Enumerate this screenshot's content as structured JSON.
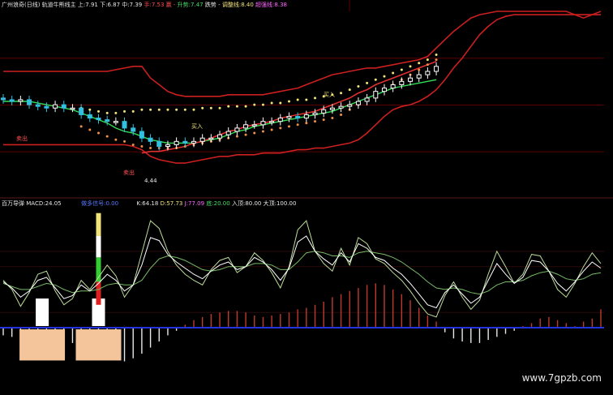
{
  "colors": {
    "background": "#000000",
    "divider": "#5a1a1a",
    "grid": "#5b0000",
    "channel": "#cc1f1f",
    "dots_upper": "#f2e27a",
    "dots_lower": "#f09048",
    "ma_green": "#33dd55",
    "ma_red": "#e03030",
    "candle_up": "#ffffff",
    "candle_down": "#33c0e0",
    "macd_pos": "#c0392b",
    "macd_neg": "#e8e8e8",
    "zero_line": "#2233dd",
    "kdj_k": "#ffffff",
    "kdj_d": "#77bb66",
    "kdj_j": "#bbdd99",
    "block_fill": "#f4c49b",
    "label_white": "#e6e6e6",
    "label_yellow": "#f2e27a",
    "label_orange": "#f08a3a",
    "label_red": "#ff4d4d",
    "label_green": "#44dd66",
    "label_blue": "#5577ff",
    "label_magenta": "#ff66ff"
  },
  "top_header": {
    "title": "广州浪奇(日线) 轨道牛熊线主",
    "up_label": "上:",
    "up_value": "7.91",
    "down_label": "下:",
    "down_value": "6.87",
    "mid_label": "中:",
    "mid_value": "7.39",
    "hold_label": "手:",
    "hold_value": "7.53",
    "buy_label": "赢 -",
    "rise_label": "升势:",
    "rise_value": "7.47",
    "fall_label": "跌势 -",
    "warn_label": "调整线:",
    "warn_value": "8.40",
    "strong_label": "超强线:",
    "strong_value": "8.38"
  },
  "bottom_header": {
    "name": "百万导弹",
    "macd_label": "MACD:",
    "macd_value": "24.05",
    "signal_label": "做多信号:",
    "signal_value": "0.00",
    "k_label": "K:",
    "k_value": "64.18",
    "d_label": "D:",
    "d_value": "57.73",
    "j_label": "J:",
    "j_value": "77.09",
    "bottom_label": "底:",
    "bottom_value": "20.00",
    "entry_label": "入顶:",
    "entry_value": "80.00",
    "top_label": "大顶:",
    "top_value": "100.00"
  },
  "annotations": [
    {
      "text": "卖出"
    },
    {
      "text": "买入"
    },
    {
      "text": "买入"
    },
    {
      "text": "4.44"
    },
    {
      "text": "卖出"
    }
  ],
  "watermark": "www.7gpzb.com",
  "chart_data": [
    {
      "type": "line",
      "name": "price_panel",
      "n": 70,
      "ylim": [
        4.0,
        9.4
      ],
      "series": [
        {
          "key": "channel_upper",
          "values": [
            7.6,
            7.6,
            7.6,
            7.6,
            7.6,
            7.6,
            7.6,
            7.6,
            7.6,
            7.6,
            7.6,
            7.6,
            7.6,
            7.65,
            7.7,
            7.75,
            7.75,
            7.4,
            7.2,
            7.0,
            6.9,
            6.85,
            6.85,
            6.85,
            6.85,
            6.85,
            6.9,
            6.9,
            6.9,
            6.9,
            6.9,
            6.95,
            7.0,
            7.05,
            7.1,
            7.2,
            7.3,
            7.4,
            7.5,
            7.55,
            7.6,
            7.65,
            7.7,
            7.7,
            7.75,
            7.8,
            7.85,
            7.9,
            7.95,
            8.05,
            8.3,
            8.55,
            8.8,
            9.0,
            9.2,
            9.3,
            9.35,
            9.4,
            9.4,
            9.4,
            9.4,
            9.4,
            9.4,
            9.4,
            9.4,
            9.4,
            9.3,
            9.2,
            9.3,
            9.4
          ]
        },
        {
          "key": "channel_lower",
          "values": [
            5.4,
            5.4,
            5.4,
            5.4,
            5.4,
            5.4,
            5.4,
            5.4,
            5.4,
            5.4,
            5.4,
            5.4,
            5.4,
            5.4,
            5.4,
            5.35,
            5.25,
            5.05,
            4.95,
            4.9,
            4.85,
            4.85,
            4.9,
            4.95,
            5.0,
            5.05,
            5.05,
            5.1,
            5.1,
            5.1,
            5.15,
            5.15,
            5.15,
            5.2,
            5.25,
            5.25,
            5.3,
            5.3,
            5.35,
            5.4,
            5.45,
            5.55,
            5.75,
            6.0,
            6.25,
            6.45,
            6.55,
            6.6,
            6.7,
            6.85,
            7.05,
            7.35,
            7.7,
            8.0,
            8.35,
            8.7,
            8.95,
            9.15,
            9.25,
            9.3,
            9.3,
            9.3,
            9.3,
            9.3,
            9.3,
            9.3,
            9.3,
            9.3,
            9.3,
            9.3
          ]
        },
        {
          "key": "dots_upper",
          "values": [
            null,
            null,
            null,
            null,
            null,
            null,
            null,
            null,
            null,
            6.5,
            6.45,
            6.4,
            6.35,
            6.35,
            6.4,
            6.4,
            6.45,
            6.45,
            6.45,
            6.45,
            6.45,
            6.45,
            6.45,
            6.5,
            6.5,
            6.5,
            6.55,
            6.55,
            6.55,
            6.6,
            6.6,
            6.65,
            6.65,
            6.7,
            6.75,
            6.75,
            6.8,
            6.85,
            6.9,
            6.95,
            7.05,
            7.15,
            7.25,
            7.35,
            7.45,
            7.55,
            7.65,
            7.75,
            7.85,
            7.95,
            8.1,
            null,
            null,
            null,
            null,
            null,
            null,
            null,
            null,
            null,
            null,
            null,
            null,
            null,
            null,
            null,
            null,
            null,
            null,
            null
          ]
        },
        {
          "key": "dots_lower",
          "values": [
            null,
            null,
            null,
            null,
            null,
            null,
            null,
            null,
            null,
            5.95,
            5.85,
            5.75,
            5.65,
            5.55,
            5.5,
            5.4,
            5.35,
            5.3,
            5.3,
            5.3,
            5.3,
            5.35,
            5.4,
            5.45,
            5.5,
            5.55,
            5.6,
            5.65,
            5.7,
            5.75,
            5.8,
            5.85,
            5.9,
            5.95,
            6.0,
            6.05,
            6.1,
            6.15,
            6.2,
            6.3,
            6.45,
            6.6,
            6.75,
            6.9,
            7.05,
            7.2,
            7.35,
            7.5,
            7.65,
            7.8,
            7.95,
            null,
            null,
            null,
            null,
            null,
            null,
            null,
            null,
            null,
            null,
            null,
            null,
            null,
            null,
            null,
            null,
            null,
            null,
            null
          ]
        },
        {
          "key": "ma_green",
          "values": [
            6.7,
            6.7,
            6.7,
            6.7,
            6.65,
            6.6,
            6.55,
            6.5,
            6.45,
            6.35,
            6.25,
            6.15,
            6.05,
            5.9,
            5.8,
            5.75,
            5.65,
            5.55,
            5.5,
            5.45,
            5.45,
            5.45,
            5.45,
            5.5,
            5.55,
            5.6,
            5.7,
            5.8,
            5.85,
            5.95,
            6.0,
            6.05,
            6.1,
            6.15,
            6.2,
            6.25,
            6.3,
            6.35,
            6.4,
            6.5,
            6.6,
            6.7,
            6.8,
            6.9,
            7.0,
            7.1,
            7.15,
            7.2,
            7.25,
            7.3,
            7.35,
            null,
            null,
            null,
            null,
            null,
            null,
            null,
            null,
            null,
            null,
            null,
            null,
            null,
            null,
            null,
            null,
            null,
            null,
            null
          ]
        },
        {
          "key": "ma_red",
          "values": [
            null,
            null,
            null,
            null,
            null,
            null,
            null,
            null,
            null,
            null,
            null,
            null,
            null,
            null,
            null,
            null,
            5.15,
            5.2,
            5.2,
            5.25,
            5.3,
            5.35,
            5.45,
            5.5,
            5.6,
            5.7,
            5.8,
            5.85,
            5.95,
            6.0,
            6.05,
            6.1,
            6.2,
            6.25,
            6.3,
            6.35,
            6.4,
            6.5,
            6.6,
            6.7,
            6.8,
            6.95,
            7.05,
            7.2,
            7.3,
            7.4,
            7.5,
            7.6,
            7.7,
            7.8,
            7.9,
            null,
            null,
            null,
            null,
            null,
            null,
            null,
            null,
            null,
            null,
            null,
            null,
            null,
            null,
            null,
            null,
            null,
            null,
            null
          ]
        },
        {
          "key": "candle_o",
          "values": [
            6.8,
            6.75,
            6.7,
            6.75,
            6.6,
            6.55,
            6.5,
            6.6,
            6.5,
            6.5,
            6.3,
            6.2,
            6.15,
            6.1,
            6.1,
            5.9,
            5.8,
            5.6,
            5.5,
            5.35,
            5.4,
            5.5,
            5.45,
            5.5,
            5.6,
            5.6,
            5.7,
            5.8,
            5.9,
            6.0,
            6.0,
            6.1,
            6.1,
            6.2,
            6.25,
            6.2,
            6.3,
            6.35,
            6.45,
            6.5,
            6.55,
            6.6,
            6.7,
            6.8,
            7.0,
            7.1,
            7.2,
            7.3,
            7.4,
            7.5,
            7.6,
            null,
            null,
            null,
            null,
            null,
            null,
            null,
            null,
            null,
            null,
            null,
            null,
            null,
            null,
            null,
            null,
            null,
            null,
            null
          ]
        },
        {
          "key": "candle_c",
          "values": [
            6.75,
            6.7,
            6.75,
            6.6,
            6.55,
            6.5,
            6.6,
            6.5,
            6.5,
            6.3,
            6.2,
            6.15,
            6.1,
            6.1,
            5.9,
            5.8,
            5.6,
            5.5,
            5.35,
            5.4,
            5.5,
            5.45,
            5.5,
            5.6,
            5.6,
            5.7,
            5.8,
            5.9,
            6.0,
            6.0,
            6.1,
            6.1,
            6.2,
            6.25,
            6.2,
            6.3,
            6.35,
            6.45,
            6.5,
            6.55,
            6.6,
            6.7,
            6.8,
            7.0,
            7.1,
            7.2,
            7.3,
            7.4,
            7.5,
            7.6,
            7.75,
            null,
            null,
            null,
            null,
            null,
            null,
            null,
            null,
            null,
            null,
            null,
            null,
            null,
            null,
            null,
            null,
            null,
            null,
            null
          ]
        }
      ]
    },
    {
      "type": "bar",
      "name": "indicator_panel",
      "n": 70,
      "ylim": [
        -70,
        155
      ],
      "series": [
        {
          "key": "macd",
          "values": [
            -10,
            -12,
            -14,
            -18,
            -20,
            -24,
            -28,
            -26,
            -20,
            -14,
            -10,
            -22,
            -30,
            -38,
            -44,
            -40,
            -34,
            -26,
            -18,
            -10,
            -4,
            4,
            10,
            14,
            18,
            20,
            22,
            22,
            20,
            16,
            14,
            16,
            18,
            20,
            24,
            26,
            30,
            34,
            40,
            44,
            48,
            52,
            56,
            58,
            56,
            50,
            44,
            36,
            26,
            16,
            8,
            -6,
            -14,
            -18,
            -20,
            -20,
            -16,
            -12,
            -8,
            -4,
            2,
            6,
            12,
            14,
            10,
            6,
            2,
            8,
            12,
            24
          ]
        },
        {
          "key": "kdj_k",
          "values": [
            60,
            52,
            40,
            48,
            62,
            66,
            52,
            38,
            42,
            56,
            48,
            58,
            70,
            62,
            48,
            56,
            82,
            118,
            114,
            96,
            86,
            78,
            70,
            64,
            74,
            82,
            86,
            76,
            80,
            92,
            86,
            76,
            62,
            78,
            112,
            120,
            100,
            90,
            82,
            98,
            86,
            110,
            104,
            92,
            88,
            78,
            70,
            58,
            44,
            30,
            26,
            46,
            56,
            44,
            32,
            40,
            62,
            84,
            70,
            58,
            66,
            88,
            86,
            74,
            58,
            48,
            60,
            74,
            86,
            78
          ]
        },
        {
          "key": "kdj_d",
          "values": [
            58,
            54,
            50,
            50,
            54,
            58,
            56,
            50,
            46,
            48,
            48,
            50,
            56,
            58,
            56,
            56,
            62,
            78,
            90,
            94,
            92,
            88,
            82,
            76,
            74,
            76,
            80,
            80,
            80,
            84,
            84,
            82,
            76,
            76,
            86,
            98,
            100,
            98,
            94,
            94,
            92,
            98,
            100,
            98,
            96,
            92,
            86,
            78,
            70,
            60,
            52,
            50,
            52,
            50,
            46,
            44,
            48,
            56,
            60,
            60,
            62,
            68,
            72,
            74,
            70,
            64,
            62,
            64,
            70,
            72
          ]
        },
        {
          "key": "kdj_j",
          "values": [
            62,
            50,
            28,
            46,
            70,
            74,
            48,
            30,
            38,
            62,
            50,
            66,
            82,
            68,
            40,
            56,
            98,
            140,
            130,
            100,
            82,
            70,
            62,
            56,
            76,
            88,
            92,
            72,
            80,
            98,
            88,
            72,
            52,
            80,
            128,
            140,
            100,
            84,
            74,
            104,
            82,
            118,
            110,
            90,
            84,
            72,
            62,
            48,
            32,
            18,
            14,
            42,
            60,
            40,
            24,
            36,
            70,
            100,
            80,
            58,
            70,
            96,
            94,
            74,
            50,
            40,
            58,
            80,
            98,
            84
          ]
        },
        {
          "key": "block_a",
          "values": [
            48
          ]
        },
        {
          "key": "block_b",
          "values": [
            48
          ]
        }
      ]
    }
  ]
}
